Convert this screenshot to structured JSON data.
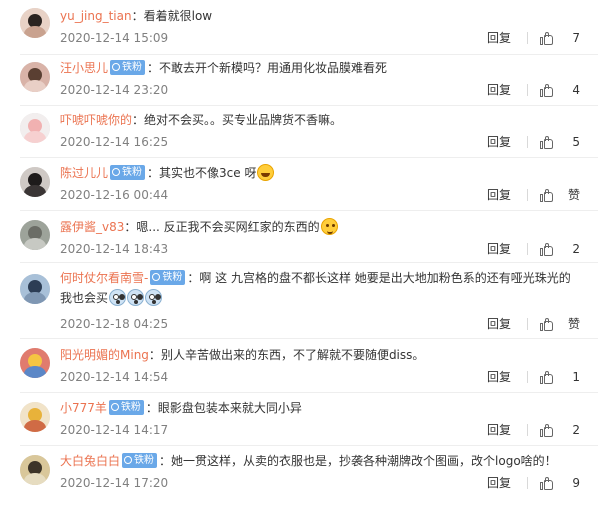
{
  "comments": [
    {
      "user": "yu_jing_tian",
      "badge": "",
      "text": "看着就很low",
      "emoji": [],
      "time": "2020-12-14 15:09",
      "reply": "回复",
      "likes": "7",
      "avatar_colors": [
        "#e8d2c6",
        "#2b2420",
        "#c9a28f"
      ]
    },
    {
      "user": "汪小思儿",
      "badge": "铁粉",
      "text": "不敢去开个新模吗？用通用化妆品膜难看死",
      "emoji": [],
      "time": "2020-12-14 23:20",
      "reply": "回复",
      "likes": "4",
      "avatar_colors": [
        "#d9b3a8",
        "#5a3f32",
        "#e9cfc6"
      ]
    },
    {
      "user": "吓唬吓唬你的",
      "badge": "",
      "text": "绝对不会买。。买专业品牌货不香嘛。",
      "emoji": [],
      "time": "2020-12-14 16:25",
      "reply": "回复",
      "likes": "5",
      "avatar_colors": [
        "#f2eeee",
        "#f1b1b1",
        "#f6d0d0"
      ]
    },
    {
      "user": "陈过儿儿",
      "badge": "铁粉",
      "text": "其实也不像3ce 呀",
      "emoji": [
        "laugh"
      ],
      "time": "2020-12-16 00:44",
      "reply": "回复",
      "likes": "赞",
      "avatar_colors": [
        "#cfc9c5",
        "#1e1b1b",
        "#3a3535"
      ]
    },
    {
      "user": "露伊酱_v83",
      "badge": "",
      "text": "嗯... 反正我不会买网红家的东西的",
      "emoji": [
        "wink"
      ],
      "time": "2020-12-14 18:43",
      "reply": "回复",
      "likes": "2",
      "avatar_colors": [
        "#9da39a",
        "#6b6d66",
        "#c7c9c3"
      ]
    },
    {
      "user": "何时仗尔看南雪-",
      "badge": "铁粉",
      "text": "啊 这 九宫格的盘不都长这样 她要是出大地加粉色系的还有哑光珠光的我也会买",
      "emoji": [
        "scream",
        "scream",
        "scream"
      ],
      "time": "2020-12-18 04:25",
      "reply": "回复",
      "likes": "赞",
      "avatar_colors": [
        "#a8c0d8",
        "#2c3d55",
        "#7f97b3"
      ]
    },
    {
      "user": "阳光明媚的Ming",
      "badge": "",
      "text": "别人辛苦做出来的东西，不了解就不要随便diss。",
      "emoji": [],
      "time": "2020-12-14 14:54",
      "reply": "回复",
      "likes": "1",
      "avatar_colors": [
        "#e07b6e",
        "#f5c542",
        "#5b87c7"
      ]
    },
    {
      "user": "小777羊",
      "badge": "铁粉",
      "text": "眼影盘包装本来就大同小异",
      "emoji": [],
      "time": "2020-12-14 14:17",
      "reply": "回复",
      "likes": "2",
      "avatar_colors": [
        "#f1e3c8",
        "#e8b23a",
        "#d06b45"
      ]
    },
    {
      "user": "大白兔白白",
      "badge": "铁粉",
      "text": "她一贯这样，从卖的衣服也是，抄袭各种潮牌改个图画，改个logo啥的！",
      "emoji": [],
      "time": "2020-12-14 17:20",
      "reply": "回复",
      "likes": "9",
      "avatar_colors": [
        "#d9c79a",
        "#3d3428",
        "#e6dcc0"
      ]
    }
  ]
}
